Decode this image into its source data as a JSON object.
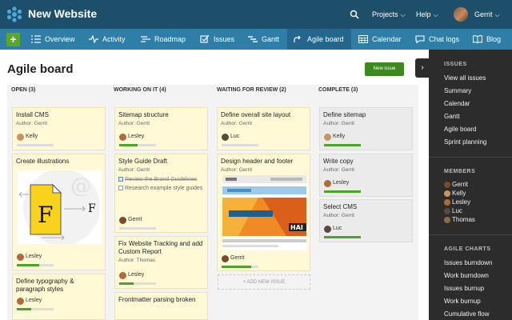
{
  "app": {
    "title": "New Website",
    "projects_label": "Projects",
    "help_label": "Help",
    "user_name": "Gerrit"
  },
  "nav": {
    "items": [
      {
        "label": "Overview",
        "icon": "list-icon"
      },
      {
        "label": "Activity",
        "icon": "activity-icon"
      },
      {
        "label": "Roadmap",
        "icon": "roadmap-icon"
      },
      {
        "label": "Issues",
        "icon": "checkbox-icon"
      },
      {
        "label": "Gantt",
        "icon": "gantt-icon"
      },
      {
        "label": "Agile board",
        "icon": "agile-icon"
      },
      {
        "label": "Calendar",
        "icon": "calendar-icon"
      },
      {
        "label": "Chat logs",
        "icon": "chat-icon"
      },
      {
        "label": "Blog",
        "icon": "blog-icon"
      }
    ],
    "active": "Agile board"
  },
  "main": {
    "title": "Agile board",
    "new_issue_label": "New issue",
    "add_new_issue_label": "+ ADD NEW ISSUE"
  },
  "columns": [
    {
      "title": "OPEN (3)"
    },
    {
      "title": "WORKING ON IT (4)"
    },
    {
      "title": "WAITING FOR REVIEW (2)"
    },
    {
      "title": "COMPLETE (3)"
    }
  ],
  "cards": {
    "open": [
      {
        "title": "Install CMS",
        "author": "Author: Gerrit",
        "assignee": "Kelly",
        "progress": 0
      },
      {
        "title": "Create illustrations",
        "assignee": "Lesley",
        "progress": 0.6
      },
      {
        "title": "Define typography & paragraph styles",
        "assignee": "Lesley",
        "progress": 0.4
      }
    ],
    "working": [
      {
        "title": "Sitemap structure",
        "author": "Author: Gerrit",
        "assignee": "Lesley",
        "progress": 0.5
      },
      {
        "title": "Style Guide Draft",
        "author": "Author: Gerrit",
        "tasks": [
          {
            "text": "Review the Brand Guidelines",
            "done": true
          },
          {
            "text": "Research example style guides",
            "done": false
          }
        ],
        "assignee": "Gerrit",
        "progress": 0
      },
      {
        "title": "Fix Website Tracking and add Custom Report",
        "author": "Author: Thomas",
        "assignee": "Lesley",
        "progress": 0.4
      },
      {
        "title": "Frontmatter parsing broken"
      }
    ],
    "review": [
      {
        "title": "Define overall site layout",
        "author": "Author: Gerrit",
        "assignee": "Luc",
        "progress": 0
      },
      {
        "title": "Design header and footer",
        "author": "Author: Gerrit",
        "assignee": "Gerrit",
        "progress": 0.8
      }
    ],
    "complete": [
      {
        "title": "Define sitemap",
        "author": "Author: Gerrit",
        "assignee": "Kelly",
        "progress": 1
      },
      {
        "title": "Write copy",
        "author": "Author: Gerrit",
        "assignee": "Lesley",
        "progress": 1
      },
      {
        "title": "Select CMS",
        "author": "Author: Gerrit",
        "assignee": "Luc",
        "progress": 1
      }
    ]
  },
  "sidebar": {
    "issues_heading": "ISSUES",
    "issues_links": [
      "View all issues",
      "Summary",
      "Calendar",
      "Gantt",
      "Agile board",
      "Sprint planning"
    ],
    "members_heading": "MEMBERS",
    "members": [
      "Gerrit",
      "Kelly",
      "Lesley",
      "Luc",
      "Thomas"
    ],
    "charts_heading": "AGILE CHARTS",
    "charts_links": [
      "Issues burndown",
      "Work burndown",
      "Issues burnup",
      "Work burnup",
      "Cumulative flow"
    ]
  },
  "colors": {
    "topbar": "#1e4f6a",
    "navbar": "#2f7ea8",
    "accent_green": "#4aa42a",
    "card_yellow": "#fff9d6",
    "card_done": "#ebebeb",
    "sidebar": "#2c2c2c"
  }
}
